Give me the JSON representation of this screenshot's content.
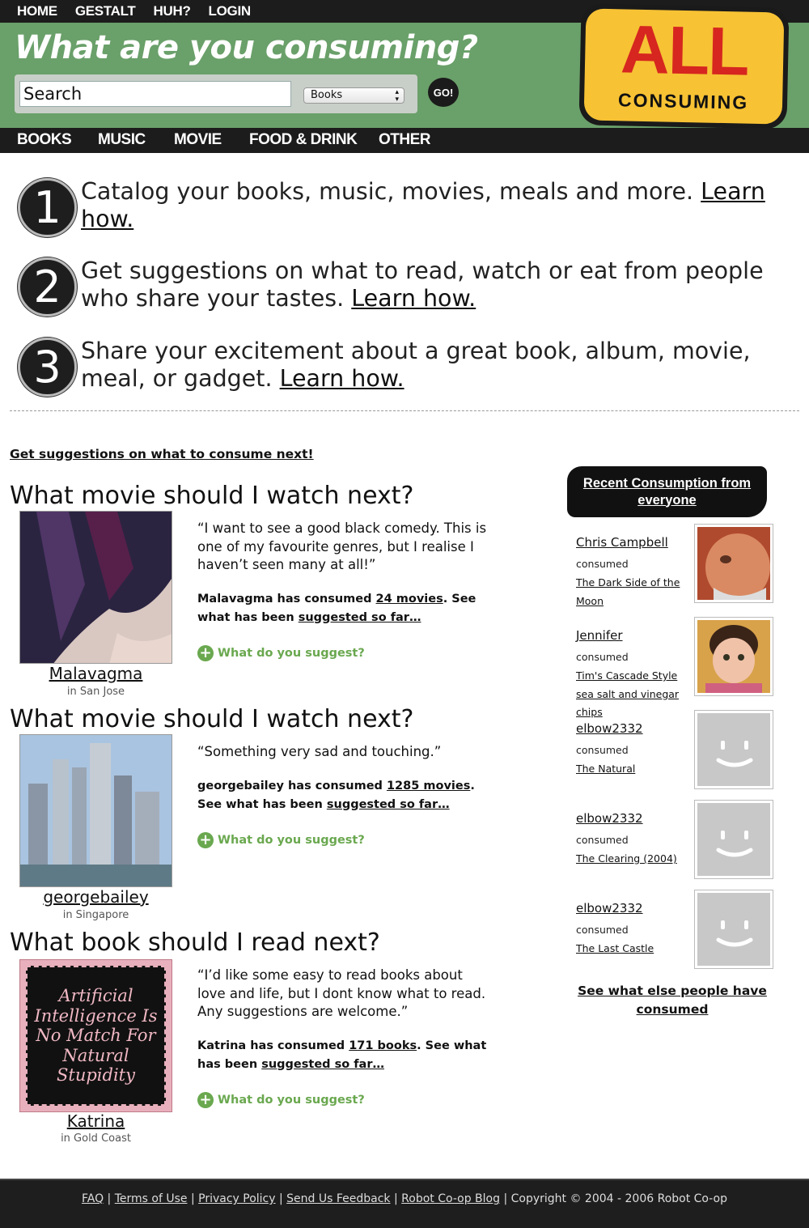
{
  "topnav": [
    "HOME",
    "GESTALT",
    "HUH?",
    "LOGIN"
  ],
  "header": {
    "tagline": "What are you consuming?",
    "search_placeholder": "Search",
    "category_selected": "Books",
    "go_label": "GO!",
    "logo_big": "ALL",
    "logo_small": "CONSUMING"
  },
  "catnav": [
    "BOOKS",
    "MUSIC",
    "MOVIE",
    "FOOD & DRINK",
    "OTHER"
  ],
  "steps": [
    {
      "num": "1",
      "text": "Catalog your books, music, movies, meals and more.",
      "link": "Learn how."
    },
    {
      "num": "2",
      "text": "Get suggestions on what to read, watch or eat from people who share your tastes.",
      "link": "Learn how."
    },
    {
      "num": "3",
      "text": "Share your excitement about a great book, album, movie, meal, or gadget.",
      "link": "Learn how."
    }
  ],
  "suggestions_link": "Get suggestions on what to consume next!",
  "requests": [
    {
      "title": "What movie should I watch next?",
      "user": "Malavagma",
      "location": "in San Jose",
      "quote": "“I want to see a good black comedy. This is one of my favourite genres, but I realise I haven’t seen many at all!”",
      "stats_pre": "Malavagma has consumed ",
      "stats_count": "24 movies",
      "stats_mid": ". See what has been ",
      "stats_link": "suggested so far…",
      "suggest": "What do you suggest?"
    },
    {
      "title": "What movie should I watch next?",
      "user": "georgebailey",
      "location": "in Singapore",
      "quote": "“Something very sad and touching.”",
      "stats_pre": "georgebailey has consumed ",
      "stats_count": "1285 movies",
      "stats_mid": ". See what has been ",
      "stats_link": "suggested so far…",
      "suggest": "What do you suggest?"
    },
    {
      "title": "What book should I read next?",
      "user": "Katrina",
      "location": "in Gold Coast",
      "quote": "“I’d like some easy to read books about love and life, but I dont know what to read. Any suggestions are welcome.”",
      "stats_pre": "Katrina has consumed ",
      "stats_count": "171 books",
      "stats_mid": ". See what has been ",
      "stats_link": "suggested so far…",
      "suggest": "What do you suggest?",
      "image_text": "Artificial Intelligence Is No Match For Natural Stupidity"
    }
  ],
  "sidebar": {
    "header": "Recent Consumption from everyone",
    "items": [
      {
        "user": "Chris Campbell",
        "verb": "consumed",
        "object": "The Dark Side of the Moon"
      },
      {
        "user": "Jennifer",
        "verb": "consumed",
        "object": "Tim's Cascade Style sea salt and vinegar chips"
      },
      {
        "user": "elbow2332",
        "verb": "consumed",
        "object": "The Natural"
      },
      {
        "user": "elbow2332",
        "verb": "consumed",
        "object": "The Clearing (2004)"
      },
      {
        "user": "elbow2332",
        "verb": "consumed",
        "object": "The Last Castle"
      }
    ],
    "see_more": "See what else people have consumed"
  },
  "footer": {
    "links": [
      "FAQ",
      "Terms of Use",
      "Privacy Policy",
      "Send Us Feedback",
      "Robot Co-op Blog"
    ],
    "copyright": "Copyright © 2004 - 2006 Robot Co-op"
  }
}
